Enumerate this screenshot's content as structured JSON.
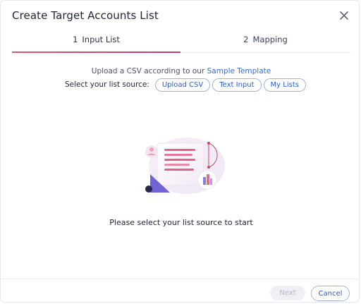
{
  "dialog": {
    "title": "Create Target Accounts List",
    "close_icon": "close-icon"
  },
  "steps": [
    {
      "number": "1",
      "label": "Input List",
      "active": true
    },
    {
      "number": "2",
      "label": "Mapping",
      "active": false
    }
  ],
  "upload": {
    "prefix": "Upload a CSV according to our",
    "link": "Sample Template"
  },
  "source": {
    "label": "Select your list source:",
    "options": [
      "Upload CSV",
      "Text Input",
      "My Lists"
    ]
  },
  "illustration_icon": "document-chart-illustration",
  "empty_state": "Please select your list source to start",
  "footer": {
    "next_label": "Next",
    "cancel_label": "Cancel"
  },
  "colors": {
    "accent_gradient_start": "#e05670",
    "accent_gradient_end": "#c53b6a",
    "link_blue": "#3a6bd6",
    "pill_border": "#9fb3e2"
  }
}
